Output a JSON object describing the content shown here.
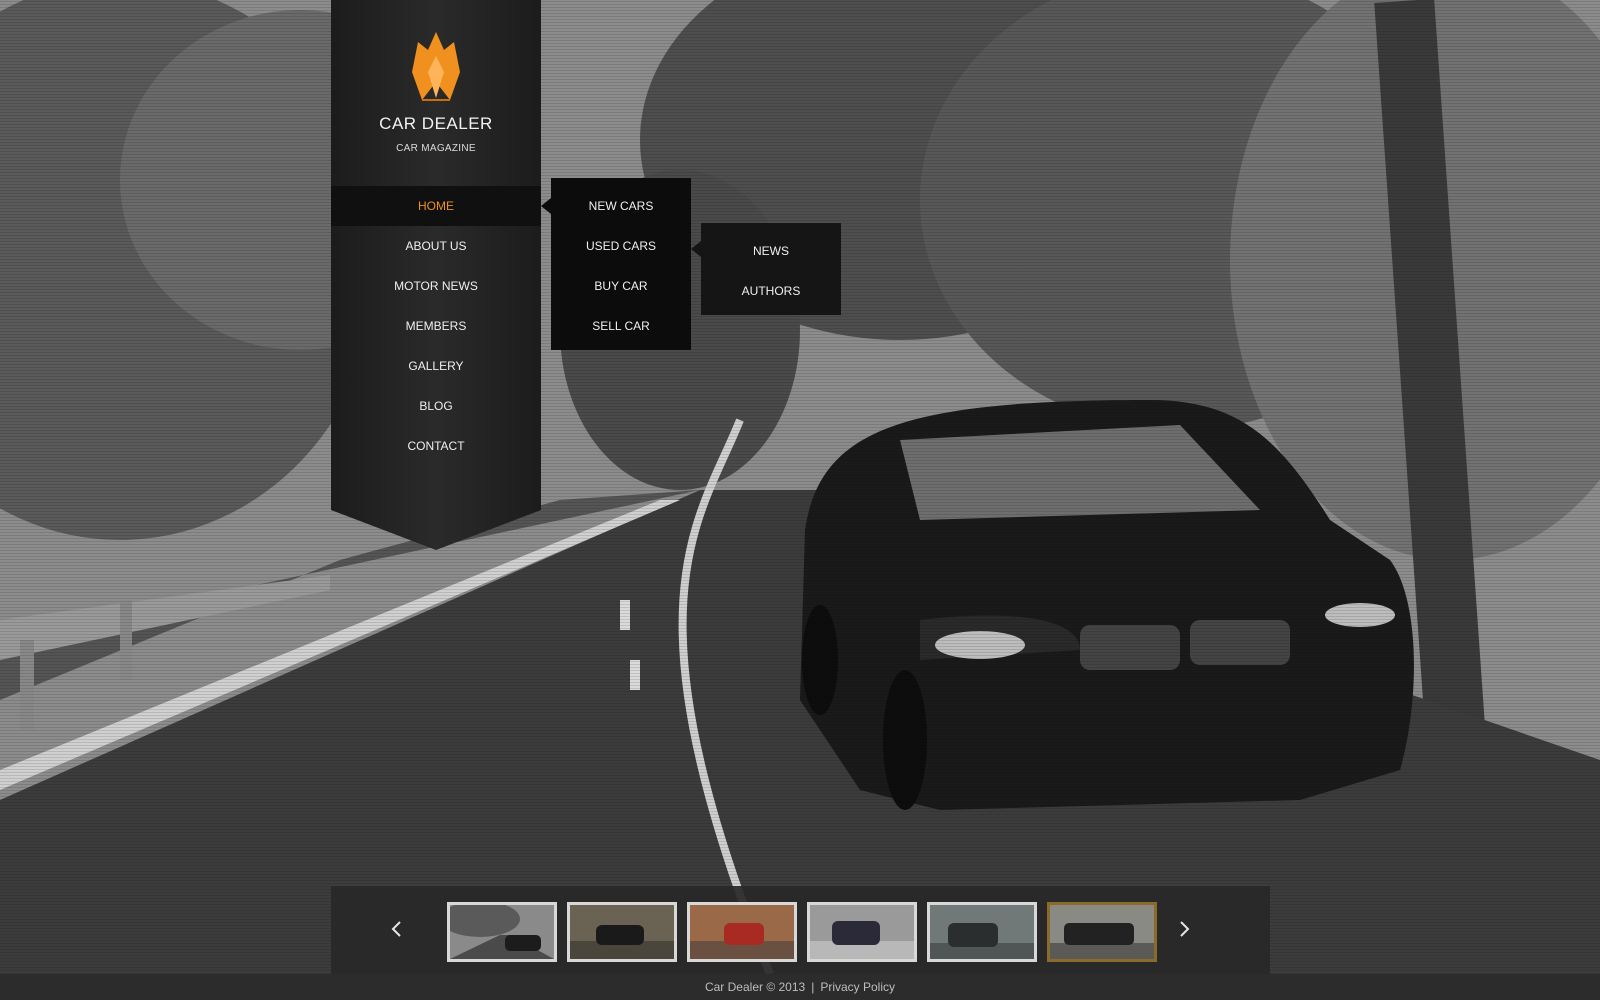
{
  "brand": {
    "title": "CAR DEALER",
    "subtitle": "CAR MAGAZINE",
    "logo_icon": "flame-crown-icon",
    "accent_color": "#f0901e"
  },
  "menu": {
    "items": [
      {
        "label": "HOME",
        "active": true
      },
      {
        "label": "ABOUT US",
        "active": false
      },
      {
        "label": "MOTOR NEWS",
        "active": false
      },
      {
        "label": "MEMBERS",
        "active": false
      },
      {
        "label": "GALLERY",
        "active": false
      },
      {
        "label": "BLOG",
        "active": false
      },
      {
        "label": "CONTACT",
        "active": false
      }
    ]
  },
  "submenu_level1": {
    "items": [
      "NEW CARS",
      "USED CARS",
      "BUY CAR",
      "SELL CAR"
    ]
  },
  "submenu_level2": {
    "items": [
      "NEWS",
      "AUTHORS"
    ]
  },
  "gallery": {
    "prev_icon": "chevron-left-icon",
    "next_icon": "chevron-right-icon",
    "thumbnails": [
      {
        "active": false,
        "tone": "#6d6d6d"
      },
      {
        "active": false,
        "tone": "#5c5648"
      },
      {
        "active": false,
        "tone": "#8a5a40"
      },
      {
        "active": false,
        "tone": "#7d7d7d"
      },
      {
        "active": false,
        "tone": "#5a6060"
      },
      {
        "active": true,
        "tone": "#60605a"
      }
    ],
    "active_border_color": "#8b6a2a"
  },
  "footer": {
    "copyright": "Car Dealer © 2013",
    "separator": "|",
    "privacy_link": "Privacy Policy"
  }
}
